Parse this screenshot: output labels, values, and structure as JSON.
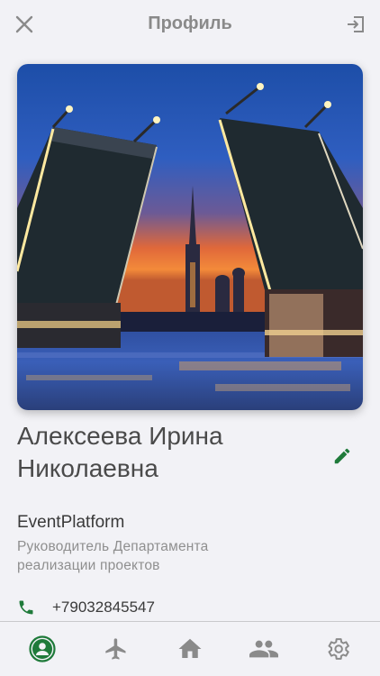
{
  "header": {
    "title": "Профиль",
    "close_icon": "close-icon",
    "logout_icon": "logout-icon"
  },
  "profile": {
    "name_line1": "Алексеева Ирина",
    "name_line2": "Николаевна",
    "company": "EventPlatform",
    "position_line1": "Руководитель Департамента",
    "position_line2": "реализации проектов",
    "phone": "+79032845547",
    "photo_icon": "photo-drawbridge"
  },
  "nav": {
    "items": [
      {
        "icon": "profile-icon",
        "active": true
      },
      {
        "icon": "airplane-icon",
        "active": false
      },
      {
        "icon": "home-icon",
        "active": false
      },
      {
        "icon": "people-icon",
        "active": false
      },
      {
        "icon": "settings-icon",
        "active": false
      }
    ]
  },
  "colors": {
    "accent": "#1f7a3a",
    "icon_gray": "#8a8a8a",
    "background": "#f2f2f6"
  }
}
